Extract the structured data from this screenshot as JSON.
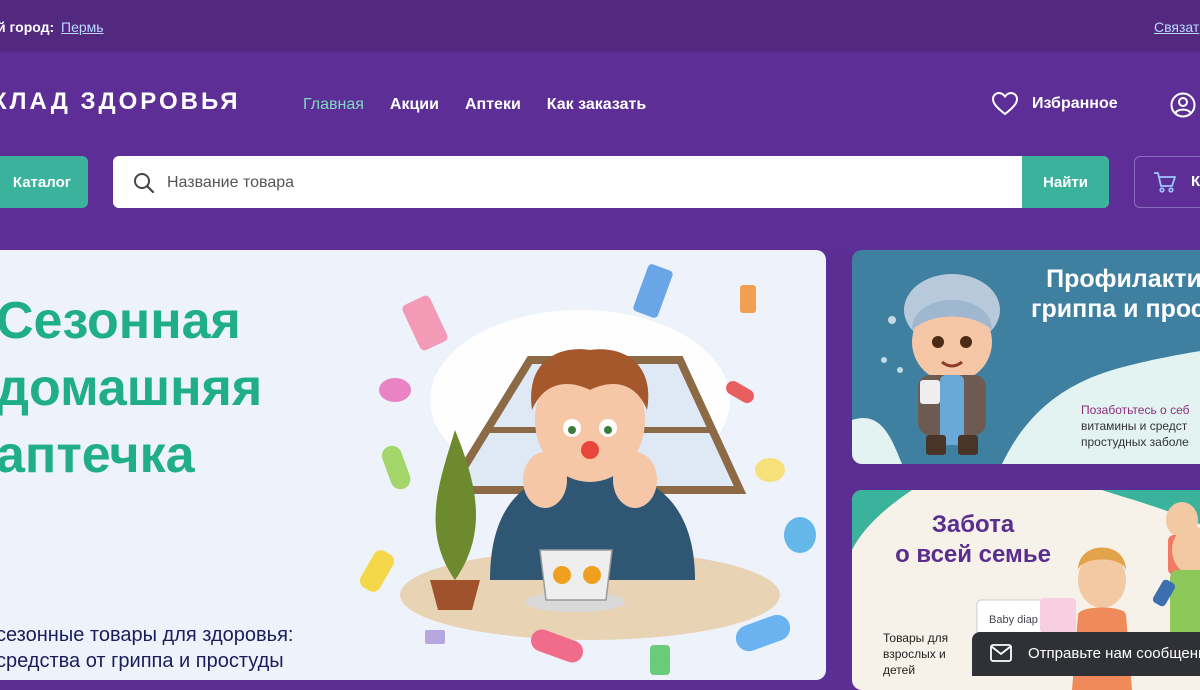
{
  "topbar": {
    "city_label": "й город:",
    "city": "Пермь",
    "contact": "Связат"
  },
  "header": {
    "logo": "КЛАД ЗДОРОВЬЯ",
    "nav": [
      "Главная",
      "Акции",
      "Аптеки",
      "Как заказать"
    ],
    "favorites": "Избранное",
    "catalog": "Каталог",
    "search_placeholder": "Название товара",
    "search_button": "Найти",
    "cart_label": "К"
  },
  "main_banner": {
    "title": "Сезонная домашняя аптечка",
    "subtitle": "сезонные товары для здоровья: средства от гриппа и простуды"
  },
  "side_banner_1": {
    "title_line1": "Профилакти",
    "title_line2": "гриппа и прост",
    "text_line1": "Позаботьтесь о себ",
    "text_line2": "витамины и средст",
    "text_line3": "простудных заболе"
  },
  "side_banner_2": {
    "title_line1": "Забота",
    "title_line2": "о всей семье",
    "text": "Товары для взрослых и детей",
    "product_label": "Baby diap"
  },
  "chat": {
    "label": "Отправьте нам сообщени"
  },
  "colors": {
    "purple": "#5d2f96",
    "accent": "#3bb39c",
    "hero_title": "#1fae86"
  }
}
